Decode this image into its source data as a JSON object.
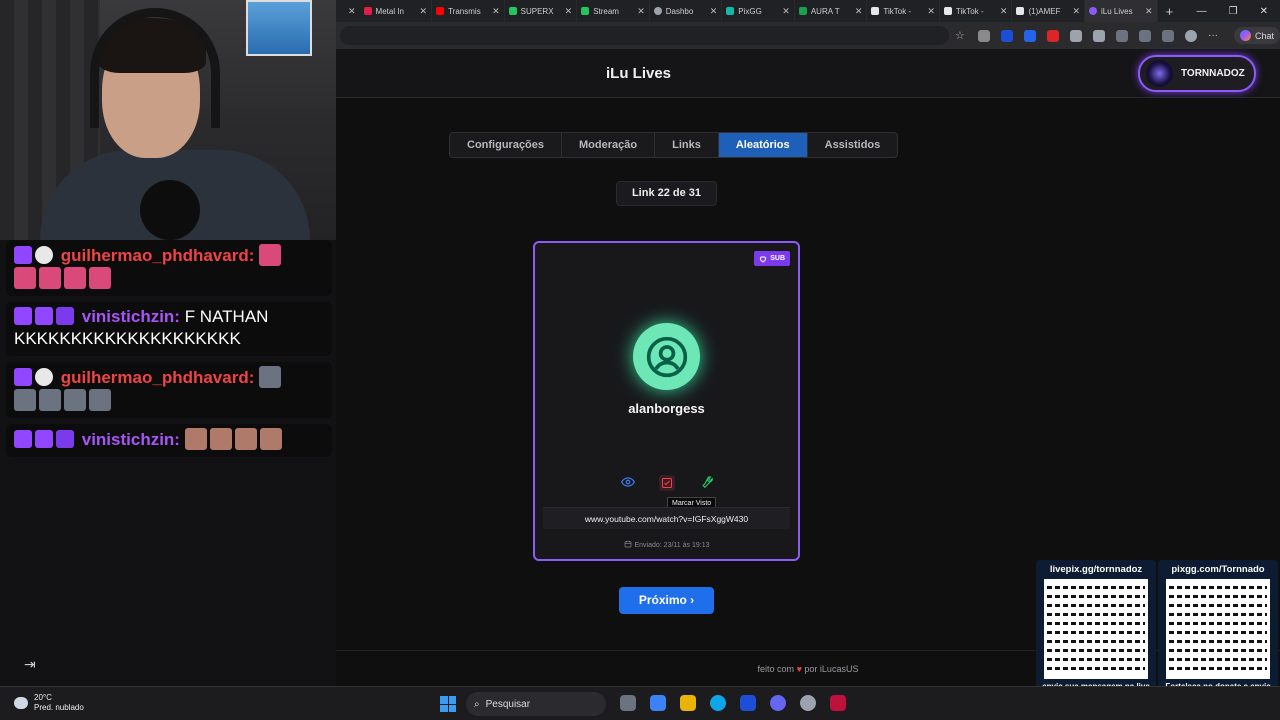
{
  "browser": {
    "tabs": [
      {
        "title": "",
        "color": "#888888"
      },
      {
        "title": "Metal In",
        "color": "#e11d48"
      },
      {
        "title": "Transmis",
        "color": "#ff0000"
      },
      {
        "title": "SUPERX",
        "color": "#22c55e"
      },
      {
        "title": "Stream",
        "color": "#22c55e"
      },
      {
        "title": "Dashbo",
        "color": "#9ca3af"
      },
      {
        "title": "PixGG",
        "color": "#14b8a6"
      },
      {
        "title": "AURA T",
        "color": "#16a34a"
      },
      {
        "title": "TikTok -",
        "color": "#e5e7eb"
      },
      {
        "title": "TikTok -",
        "color": "#e5e7eb"
      },
      {
        "title": "(1)AMEF",
        "color": "#e5e7eb"
      },
      {
        "title": "iLu Lives",
        "color": "#8b5cf6"
      }
    ],
    "new_tab": "+",
    "chat_label": "Chat"
  },
  "app": {
    "title": "iLu Lives",
    "user": "TORNNADOZ",
    "tabs": [
      "Configurações",
      "Moderação",
      "Links",
      "Aleatórios",
      "Assistidos"
    ],
    "active_tab": "Aleatórios",
    "counter": "Link 22 de 31",
    "card": {
      "badge": "SUB",
      "username": "alanborgess",
      "tooltip": "Marcar Visto",
      "url": "www.youtube.com/watch?v=IGFsXggW430",
      "sent": "Enviado: 23/11 às 19:13"
    },
    "next_label": "Próximo ›",
    "footer": {
      "prefix": "feito com",
      "suffix": "por iLucasUS"
    }
  },
  "chat": [
    {
      "user": "guilhermao_phdhavard:",
      "text": "",
      "color": "red"
    },
    {
      "user": "vinistichzin:",
      "text": "F NATHAN KKKKKKKKKKKKKKKKKKKK",
      "color": "purple"
    },
    {
      "user": "guilhermao_phdhavard:",
      "text": "",
      "color": "red"
    },
    {
      "user": "vinistichzin:",
      "text": "",
      "color": "purple"
    }
  ],
  "overlays": {
    "qr_left": {
      "top": "livepix.gg/tornnadoz",
      "bottom": "envie sua mensagem na live via pix!"
    },
    "qr_right": {
      "top": "pixgg.com/Tornnado",
      "bottom": "Fortaleça no donate e envie sua mensagem!"
    }
  },
  "taskbar": {
    "temp": "20°C",
    "weather": "Pred. nublado",
    "search": "Pesquisar"
  }
}
